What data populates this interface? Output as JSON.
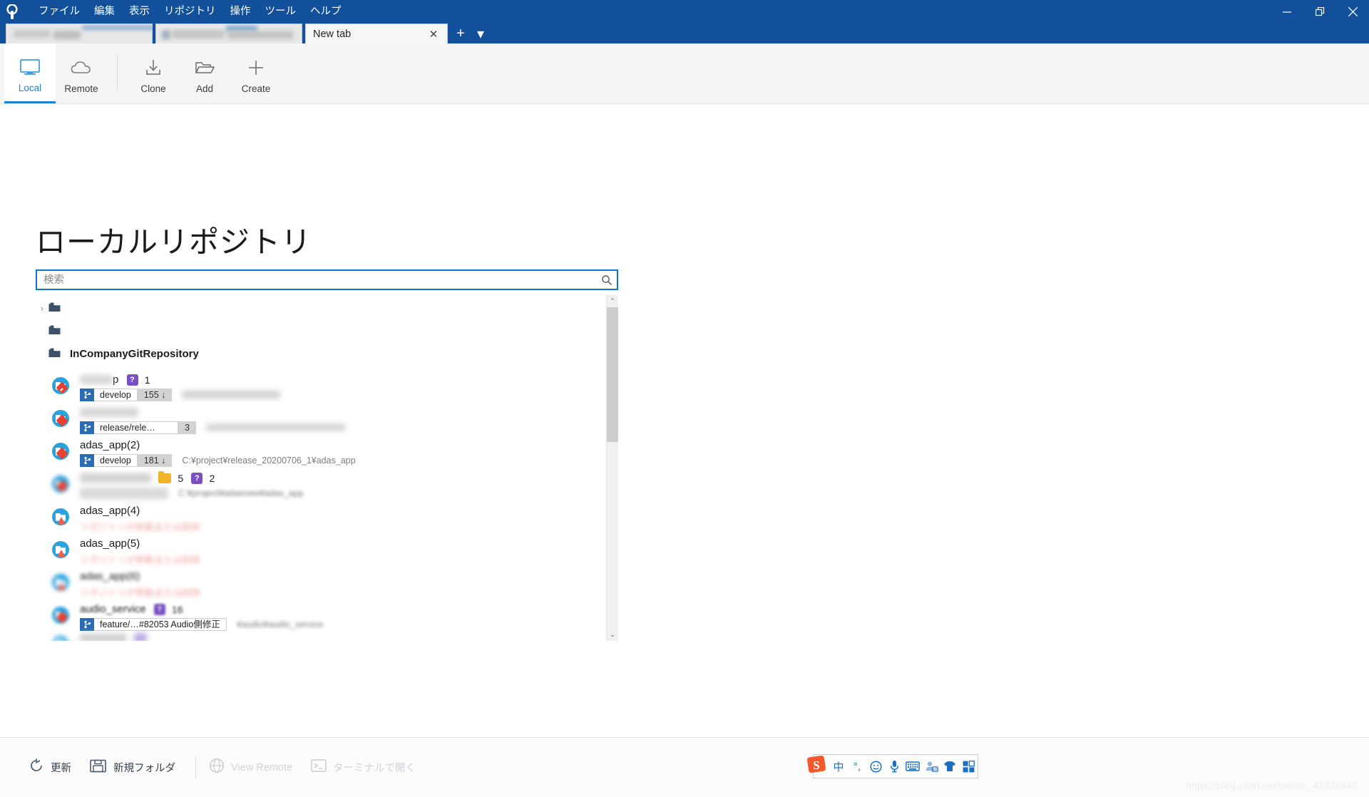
{
  "window": {
    "title_bar_color": "#12509c",
    "logo_icon": "sourcetree-logo-icon",
    "controls": {
      "minimize": "—",
      "maximize": "❐",
      "close": "✕"
    }
  },
  "menubar": {
    "items": [
      {
        "label": "ファイル",
        "name": "menu-file"
      },
      {
        "label": "編集",
        "name": "menu-edit"
      },
      {
        "label": "表示",
        "name": "menu-view"
      },
      {
        "label": "リポジトリ",
        "name": "menu-repository"
      },
      {
        "label": "操作",
        "name": "menu-actions"
      },
      {
        "label": "ツール",
        "name": "menu-tools"
      },
      {
        "label": "ヘルプ",
        "name": "menu-help"
      }
    ]
  },
  "tabs": {
    "items": [
      {
        "label": "",
        "redacted": true,
        "active": false
      },
      {
        "label": "",
        "redacted": true,
        "active": false
      },
      {
        "label": "New tab",
        "redacted": false,
        "active": true
      }
    ],
    "close_glyph": "✕",
    "new_tab_glyph": "+",
    "tab_menu_glyph": "▾"
  },
  "ribbon": {
    "items": [
      {
        "label": "Local",
        "icon": "monitor-icon",
        "selected": true
      },
      {
        "label": "Remote",
        "icon": "cloud-icon",
        "selected": false
      },
      {
        "label": "Clone",
        "icon": "download-icon",
        "selected": false
      },
      {
        "label": "Add",
        "icon": "folder-open-icon",
        "selected": false
      },
      {
        "label": "Create",
        "icon": "plus-icon",
        "selected": false
      }
    ]
  },
  "main": {
    "page_title": "ローカルリポジトリ",
    "search": {
      "value": "",
      "placeholder": "検索",
      "icon": "search-icon",
      "focused": true,
      "border_color": "#0a76d6"
    }
  },
  "tree": {
    "folders": [
      {
        "name": "",
        "redacted": true,
        "expandable": true,
        "twisty": "›",
        "indent": 0
      },
      {
        "name": "",
        "redacted": true,
        "expandable": false,
        "twisty": "",
        "indent": 1
      },
      {
        "name": "InCompanyGitRepository",
        "redacted": false,
        "expandable": false,
        "twisty": "",
        "indent": 1
      }
    ],
    "repositories": [
      {
        "name": "",
        "name_redacted": true,
        "name_suffix": "p",
        "badges": [
          {
            "type": "question",
            "glyph": "?",
            "color": "#7a4fc4",
            "count": "1"
          }
        ],
        "branch": "develop",
        "branch_count": "155 ↓",
        "path": "",
        "path_redacted": true,
        "state": "normal"
      },
      {
        "name": "",
        "name_redacted": true,
        "name_suffix": "_app(1)",
        "badges": [],
        "branch": "release/rele…",
        "branch_count": "3",
        "path": "C:¥proj…",
        "path_redacted": true,
        "state": "normal"
      },
      {
        "name": "adas_app(2)",
        "name_redacted": false,
        "name_suffix": "",
        "badges": [],
        "branch": "develop",
        "branch_count": "181 ↓",
        "path": "C:¥project¥release_20200706_1¥adas_app",
        "path_redacted": false,
        "state": "normal"
      },
      {
        "name": "",
        "name_redacted": true,
        "name_suffix": "",
        "badges": [
          {
            "type": "folder",
            "glyph": "",
            "color": "#f0b429",
            "count": "5"
          },
          {
            "type": "question",
            "glyph": "?",
            "color": "#7a4fc4",
            "count": "2"
          }
        ],
        "branch": "",
        "branch_count": "",
        "path": "C:¥project¥adasnew¥adas_app",
        "path_redacted": true,
        "state": "normal"
      },
      {
        "name": "adas_app(4)",
        "name_redacted": false,
        "name_suffix": "",
        "badges": [],
        "branch": "",
        "branch_count": "",
        "path": "",
        "path_redacted": true,
        "state": "error",
        "error_text": "リポジトリが移動または削除"
      },
      {
        "name": "adas_app(5)",
        "name_redacted": false,
        "name_suffix": "",
        "badges": [],
        "branch": "",
        "branch_count": "",
        "path": "",
        "path_redacted": true,
        "state": "error",
        "error_text": "リポジトリが移動または削除"
      },
      {
        "name": "adas_app(6)",
        "name_redacted": true,
        "name_suffix": "",
        "badges": [],
        "branch": "",
        "branch_count": "",
        "path": "",
        "path_redacted": true,
        "state": "error",
        "error_text": "リポジトリが移動または削除"
      },
      {
        "name": "audio_service",
        "name_redacted": true,
        "name_suffix": "",
        "badges": [
          {
            "type": "question",
            "glyph": "?",
            "color": "#7a4fc4",
            "count": "16"
          }
        ],
        "branch": "feature/…#82053 Audio側修正",
        "branch_count": "",
        "path": "¥audio¥audio_service",
        "path_redacted": true,
        "state": "normal"
      }
    ]
  },
  "scrollbar": {
    "up_glyph": "⌃",
    "down_glyph": "⌄",
    "thumb_top_pct": 0,
    "thumb_height_pct": 42
  },
  "statusbar": {
    "items": [
      {
        "label": "更新",
        "icon": "refresh-icon",
        "disabled": false
      },
      {
        "label": "新規フォルダ",
        "icon": "new-folder-icon",
        "disabled": false
      },
      {
        "label": "View Remote",
        "icon": "globe-icon",
        "disabled": true
      },
      {
        "label": "ターミナルで開く",
        "icon": "terminal-icon",
        "disabled": true
      }
    ]
  },
  "ime": {
    "logo": "sogou-logo-icon",
    "buttons": [
      {
        "glyph": "中",
        "name": "ime-mode-chinese"
      },
      {
        "glyph": "°,",
        "name": "ime-punctuation"
      },
      {
        "glyph": "☺",
        "name": "ime-emoji"
      },
      {
        "glyph": "🎙",
        "name": "ime-voice"
      },
      {
        "glyph": "⌨",
        "name": "ime-keyboard"
      },
      {
        "glyph": "👤",
        "name": "ime-user"
      },
      {
        "glyph": "👕",
        "name": "ime-skin"
      },
      {
        "glyph": "▦",
        "name": "ime-toolbox"
      }
    ]
  },
  "watermark": {
    "text": "https://blog.csdn.net/weixin_45328645"
  }
}
